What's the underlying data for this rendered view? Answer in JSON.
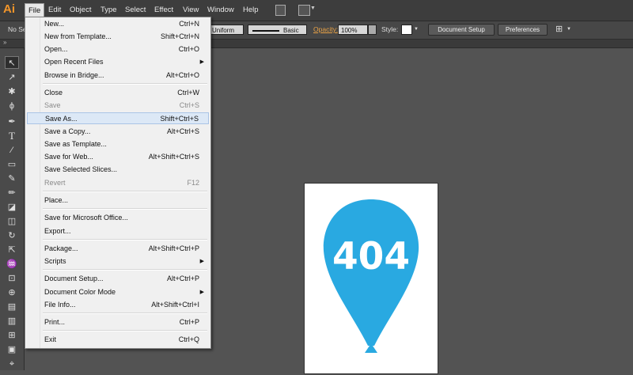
{
  "app": {
    "logo": "Ai"
  },
  "menubar": {
    "items": [
      "File",
      "Edit",
      "Object",
      "Type",
      "Select",
      "Effect",
      "View",
      "Window",
      "Help"
    ],
    "active": "File"
  },
  "control_bar": {
    "selection_label": "No Se",
    "stroke_profile": "Uniform",
    "brush": "Basic",
    "opacity_label": "Opacity:",
    "opacity_value": "100%",
    "style_label": "Style:",
    "document_setup_button": "Document Setup",
    "preferences_button": "Preferences"
  },
  "file_menu": {
    "items": [
      {
        "label": "New...",
        "shortcut": "Ctrl+N"
      },
      {
        "label": "New from Template...",
        "shortcut": "Shift+Ctrl+N"
      },
      {
        "label": "Open...",
        "shortcut": "Ctrl+O"
      },
      {
        "label": "Open Recent Files",
        "shortcut": "",
        "submenu": true
      },
      {
        "label": "Browse in Bridge...",
        "shortcut": "Alt+Ctrl+O"
      },
      {
        "label": "Close",
        "shortcut": "Ctrl+W"
      },
      {
        "label": "Save",
        "shortcut": "Ctrl+S",
        "disabled": true
      },
      {
        "label": "Save As...",
        "shortcut": "Shift+Ctrl+S",
        "hover": true
      },
      {
        "label": "Save a Copy...",
        "shortcut": "Alt+Ctrl+S"
      },
      {
        "label": "Save as Template...",
        "shortcut": ""
      },
      {
        "label": "Save for Web...",
        "shortcut": "Alt+Shift+Ctrl+S"
      },
      {
        "label": "Save Selected Slices...",
        "shortcut": ""
      },
      {
        "label": "Revert",
        "shortcut": "F12",
        "disabled": true
      },
      {
        "label": "Place...",
        "shortcut": ""
      },
      {
        "label": "Save for Microsoft Office...",
        "shortcut": ""
      },
      {
        "label": "Export...",
        "shortcut": ""
      },
      {
        "label": "Package...",
        "shortcut": "Alt+Shift+Ctrl+P"
      },
      {
        "label": "Scripts",
        "shortcut": "",
        "submenu": true
      },
      {
        "label": "Document Setup...",
        "shortcut": "Alt+Ctrl+P"
      },
      {
        "label": "Document Color Mode",
        "shortcut": "",
        "submenu": true
      },
      {
        "label": "File Info...",
        "shortcut": "Alt+Shift+Ctrl+I"
      },
      {
        "label": "Print...",
        "shortcut": "Ctrl+P"
      },
      {
        "label": "Exit",
        "shortcut": "Ctrl+Q"
      }
    ]
  },
  "artboard": {
    "balloon_text": "404",
    "balloon_color": "#29a9e1"
  },
  "colors": {
    "accent": "#f3962a",
    "menu_hover": "#dce8f6"
  }
}
